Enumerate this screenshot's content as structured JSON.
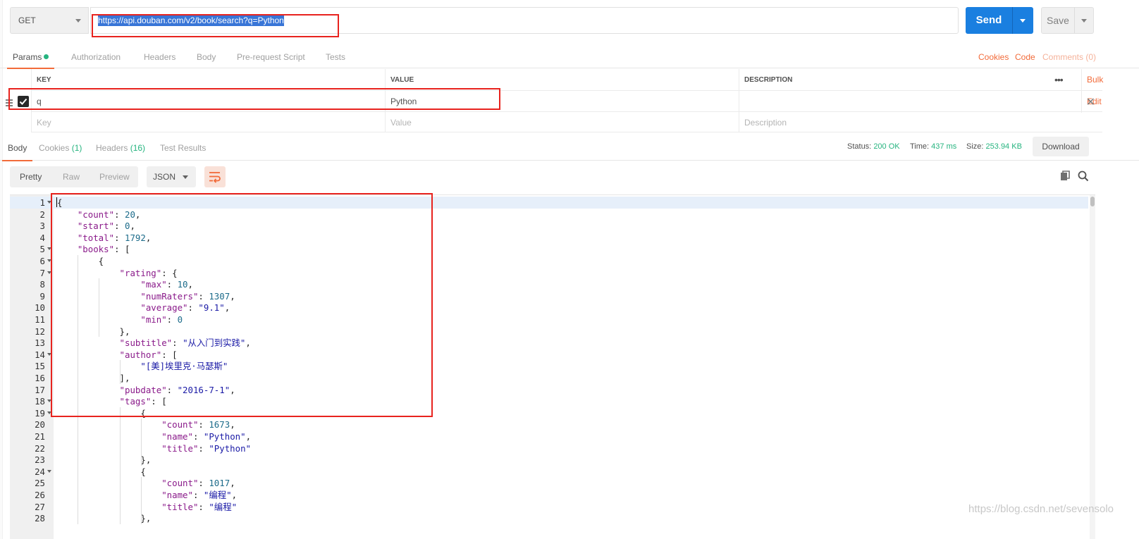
{
  "request": {
    "method": "GET",
    "url": "https://api.douban.com/v2/book/search?q=Python",
    "send_label": "Send",
    "save_label": "Save"
  },
  "request_tabs": [
    "Params",
    "Authorization",
    "Headers",
    "Body",
    "Pre-request Script",
    "Tests"
  ],
  "request_links": {
    "cookies": "Cookies",
    "code": "Code",
    "comments": "Comments (0)"
  },
  "params": {
    "headers": {
      "key": "KEY",
      "value": "VALUE",
      "description": "DESCRIPTION"
    },
    "bulk_edit": "Bulk Edit",
    "rows": [
      {
        "key": "q",
        "value": "Python",
        "description": "",
        "checked": true
      }
    ],
    "placeholders": {
      "key": "Key",
      "value": "Value",
      "description": "Description"
    }
  },
  "response_tabs": {
    "body": "Body",
    "cookies": "Cookies",
    "cookies_count": "(1)",
    "headers": "Headers",
    "headers_count": "(16)",
    "tests": "Test Results"
  },
  "status": {
    "status_label": "Status:",
    "status_value": "200 OK",
    "time_label": "Time:",
    "time_value": "437 ms",
    "size_label": "Size:",
    "size_value": "253.94 KB",
    "download": "Download"
  },
  "view_modes": [
    "Pretty",
    "Raw",
    "Preview"
  ],
  "format": "JSON",
  "code_lines": [
    "{",
    "    \"count\": 20,",
    "    \"start\": 0,",
    "    \"total\": 1792,",
    "    \"books\": [",
    "        {",
    "            \"rating\": {",
    "                \"max\": 10,",
    "                \"numRaters\": 1307,",
    "                \"average\": \"9.1\",",
    "                \"min\": 0",
    "            },",
    "            \"subtitle\": \"从入门到实践\",",
    "            \"author\": [",
    "                \"[美]埃里克·马瑟斯\"",
    "            ],",
    "            \"pubdate\": \"2016-7-1\",",
    "            \"tags\": [",
    "                {",
    "                    \"count\": 1673,",
    "                    \"name\": \"Python\",",
    "                    \"title\": \"Python\"",
    "                },",
    "                {",
    "                    \"count\": 1017,",
    "                    \"name\": \"编程\",",
    "                    \"title\": \"编程\"",
    "                },"
  ],
  "fold_lines": [
    1,
    5,
    6,
    7,
    14,
    18,
    19,
    24
  ],
  "watermark": "https://blog.csdn.net/sevensolo"
}
